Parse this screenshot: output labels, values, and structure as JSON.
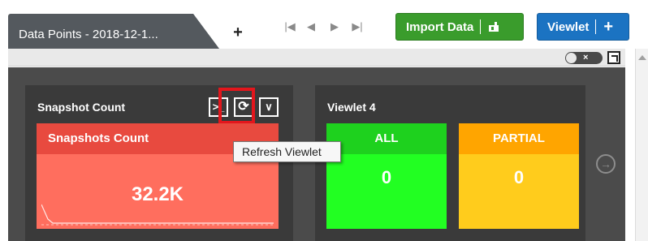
{
  "tabs": {
    "active_label": "Data Points - 2018-12-1...",
    "add_label": "+"
  },
  "pager": {
    "first": "|◀",
    "prev": "◀",
    "next": "▶",
    "last": "▶|"
  },
  "toolbar": {
    "import_label": "Import Data",
    "viewlet_label": "Viewlet",
    "viewlet_plus": "+",
    "toggle_x": "×"
  },
  "cards": [
    {
      "title": "Snapshot Count",
      "tile_header": "Snapshots Count",
      "tile_value": "32.2K",
      "console_icon": ">_",
      "refresh_icon": "⟳",
      "menu_icon": "∨"
    },
    {
      "title": "Viewlet 4",
      "tiles": [
        {
          "header": "ALL",
          "value": "0"
        },
        {
          "header": "PARTIAL",
          "value": "0"
        }
      ]
    }
  ],
  "tooltip": "Refresh Viewlet",
  "colors": {
    "import_green": "#3a9c2c",
    "viewlet_blue": "#1b73c2",
    "snapshot_red": "#ff6e5e",
    "all_green": "#22ff22",
    "partial_yellow": "#ffcc1c",
    "highlight_red": "#e3161c"
  }
}
